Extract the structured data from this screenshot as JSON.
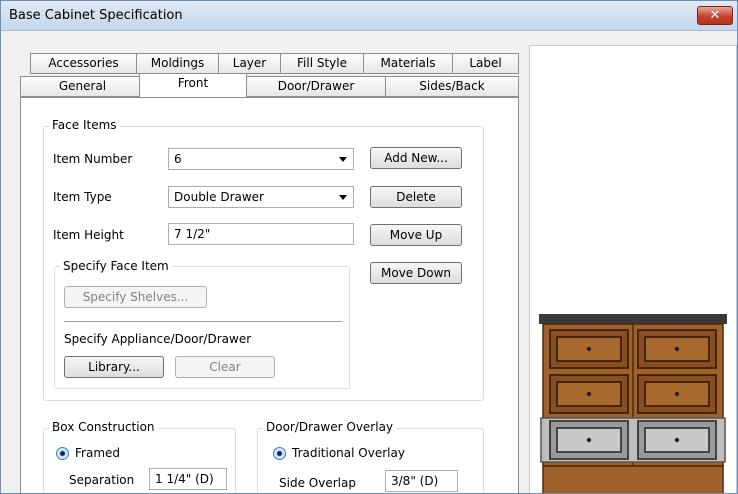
{
  "window": {
    "title": "Base Cabinet Specification"
  },
  "title_bar": {
    "close_label": "✕"
  },
  "tabs": {
    "row1": [
      "Accessories",
      "Moldings",
      "Layer",
      "Fill Style",
      "Materials",
      "Label"
    ],
    "row2": [
      "General",
      "Front",
      "Door/Drawer",
      "Sides/Back"
    ],
    "active": "Front"
  },
  "face_items": {
    "title": "Face Items",
    "item_number_label": "Item Number",
    "item_number_value": "6",
    "item_type_label": "Item Type",
    "item_type_value": "Double Drawer",
    "item_height_label": "Item Height",
    "item_height_value": "7 1/2\"",
    "add_new": "Add New...",
    "delete": "Delete",
    "move_up": "Move Up",
    "move_down": "Move Down"
  },
  "specify_face_item": {
    "title": "Specify Face Item",
    "specify_shelves": "Specify Shelves...",
    "appliance_label": "Specify Appliance/Door/Drawer",
    "library": "Library...",
    "clear": "Clear"
  },
  "box_construction": {
    "title": "Box Construction",
    "framed_label": "Framed",
    "separation_label": "Separation",
    "separation_value": "1 1/4\" (D)"
  },
  "overlay": {
    "title": "Door/Drawer Overlay",
    "traditional_label": "Traditional Overlay",
    "side_overlap_label": "Side Overlap",
    "side_overlap_value": "3/8\" (D)"
  },
  "colors": {
    "cabinet_wood": "#a0612b",
    "countertop": "#3a3a3a",
    "selected_drawer": "#c8c8c8"
  }
}
